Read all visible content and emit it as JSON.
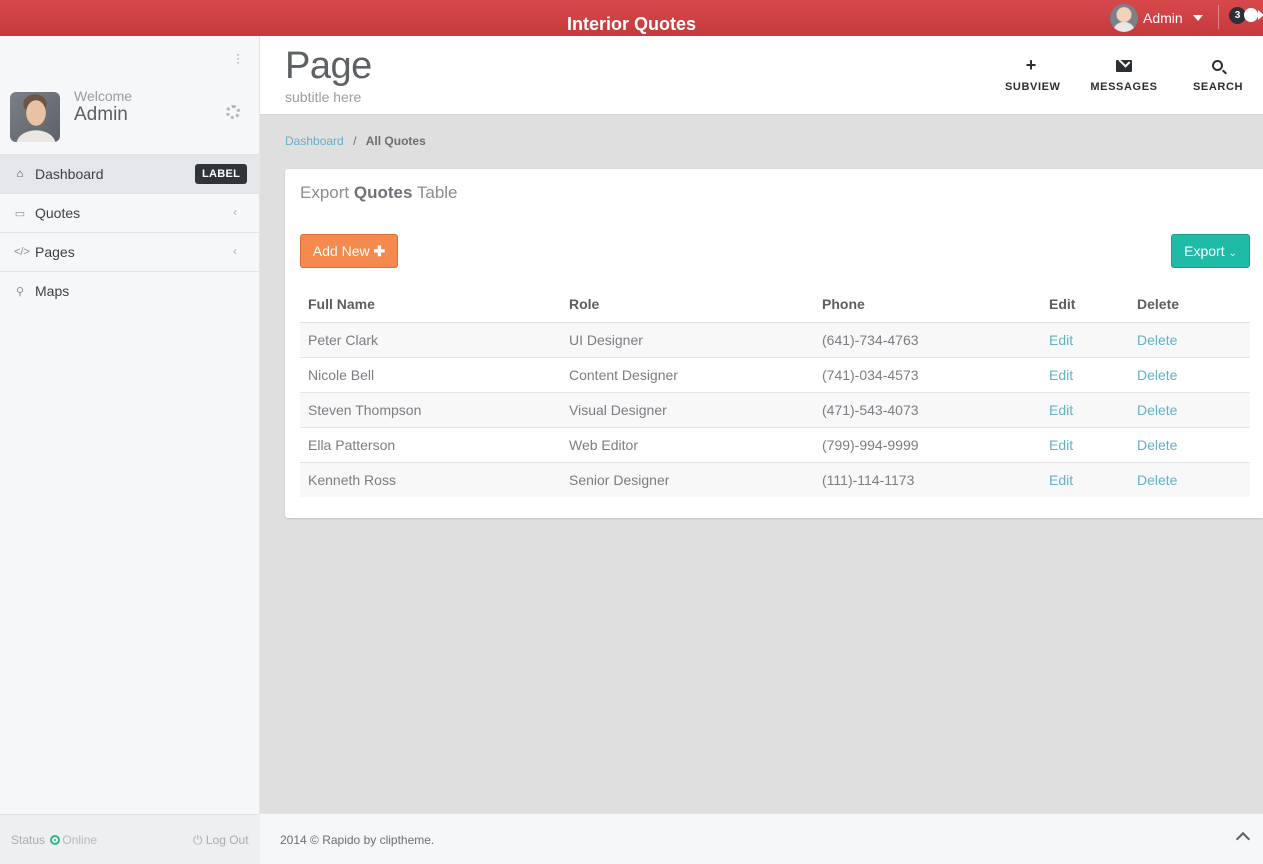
{
  "app": {
    "title": "Interior Quotes"
  },
  "topbar": {
    "user_name": "Admin",
    "notification_count": "3"
  },
  "sidebar": {
    "welcome": "Welcome",
    "user_name": "Admin",
    "items": [
      {
        "label": "Dashboard",
        "icon": "home-icon",
        "badge": "LABEL",
        "active": true
      },
      {
        "label": "Quotes",
        "icon": "desktop-icon",
        "has_submenu": true
      },
      {
        "label": "Pages",
        "icon": "code-icon",
        "has_submenu": true
      },
      {
        "label": "Maps",
        "icon": "map-marker-icon"
      }
    ],
    "status_label": "Status",
    "status_value": "Online",
    "logout_label": "Log Out"
  },
  "header": {
    "title": "Page",
    "subtitle": "subtitle here",
    "buttons": [
      {
        "label": "SUBVIEW",
        "icon": "plus-icon"
      },
      {
        "label": "MESSAGES",
        "icon": "envelope-icon"
      },
      {
        "label": "SEARCH",
        "icon": "search-icon"
      }
    ]
  },
  "breadcrumb": {
    "link": "Dashboard",
    "separator": "/",
    "current": "All Quotes"
  },
  "panel": {
    "title_pre": "Export",
    "title_bold": "Quotes",
    "title_post": "Table",
    "add_button": "Add New",
    "export_button": "Export"
  },
  "table": {
    "columns": [
      "Full Name",
      "Role",
      "Phone",
      "Edit",
      "Delete"
    ],
    "rows": [
      {
        "name": "Peter Clark",
        "role": "UI Designer",
        "phone": "(641)-734-4763",
        "edit": "Edit",
        "delete": "Delete"
      },
      {
        "name": "Nicole Bell",
        "role": "Content Designer",
        "phone": "(741)-034-4573",
        "edit": "Edit",
        "delete": "Delete"
      },
      {
        "name": "Steven Thompson",
        "role": "Visual Designer",
        "phone": "(471)-543-4073",
        "edit": "Edit",
        "delete": "Delete"
      },
      {
        "name": "Ella Patterson",
        "role": "Web Editor",
        "phone": "(799)-994-9999",
        "edit": "Edit",
        "delete": "Delete"
      },
      {
        "name": "Kenneth Ross",
        "role": "Senior Designer",
        "phone": "(111)-114-1173",
        "edit": "Edit",
        "delete": "Delete"
      }
    ]
  },
  "footer": {
    "copyright": "2014 © Rapido by cliptheme."
  },
  "colors": {
    "topbar": "#c53a3d",
    "add_button": "#f58a4f",
    "export_button": "#1fbba6",
    "link": "#64b0c6"
  }
}
